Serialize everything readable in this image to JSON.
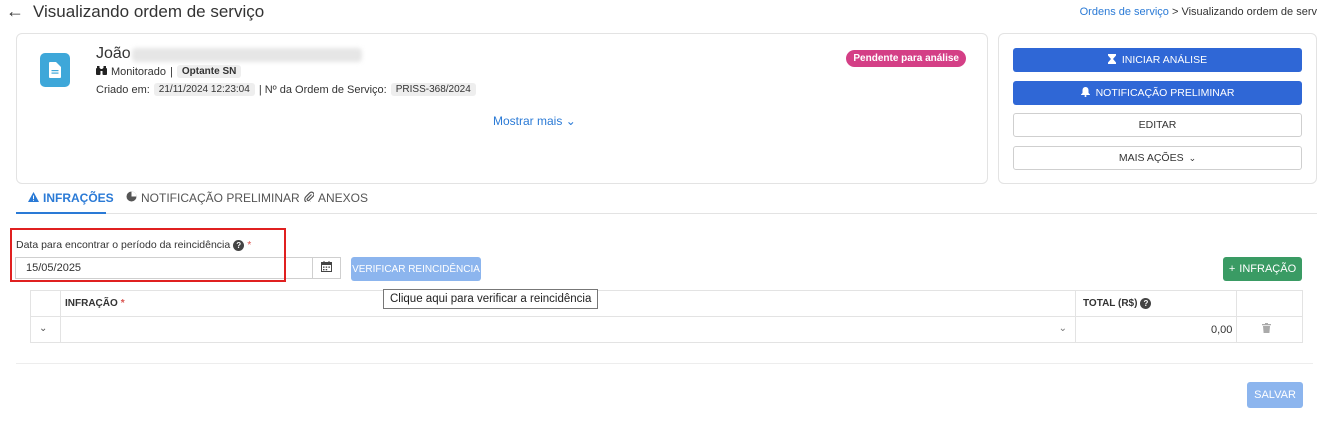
{
  "header": {
    "title": "Visualizando ordem de serviço",
    "breadcrumb": {
      "link": "Ordens de serviço",
      "separator": ">",
      "current": "Visualizando ordem de serv"
    }
  },
  "summary": {
    "name": "João",
    "monitor_label": "Monitorado",
    "pipe": "|",
    "regime_chip": "Optante SN",
    "created_label": "Criado em:",
    "created_value": "21/11/2024 12:23:04",
    "order_label": "| Nº da Ordem de Serviço:",
    "order_value": "PRISS-368/2024",
    "status_badge": "Pendente para análise",
    "status_color": "#d43f86",
    "show_more": "Mostrar mais"
  },
  "actions": {
    "start_analysis": "INICIAR ANÁLISE",
    "preliminary_notification": "NOTIFICAÇÃO PRELIMINAR",
    "edit": "EDITAR",
    "more_actions": "MAIS AÇÕES",
    "primary_color": "#2f67d6"
  },
  "tabs": [
    {
      "label": "INFRAÇÕES",
      "icon": "warning-icon",
      "active": true
    },
    {
      "label": "NOTIFICAÇÃO PRELIMINAR",
      "icon": "pie-chart-icon",
      "active": false
    },
    {
      "label": "ANEXOS",
      "icon": "paperclip-icon",
      "active": false
    }
  ],
  "form": {
    "date_label": "Data para encontrar o período da reincidência",
    "required_mark": "*",
    "date_value": "15/05/2025",
    "verify_button": "VERIFICAR REINCIDÊNCIA",
    "add_infraction_button": "INFRAÇÃO",
    "add_color": "#3a9b64",
    "tooltip": "Clique aqui para verificar a reincidência"
  },
  "table": {
    "columns": [
      "INFRAÇÃO",
      "TOTAL (R$)"
    ],
    "rows": [
      {
        "infraction": "",
        "total": "0,00"
      }
    ]
  },
  "footer": {
    "save_button": "SALVAR"
  }
}
